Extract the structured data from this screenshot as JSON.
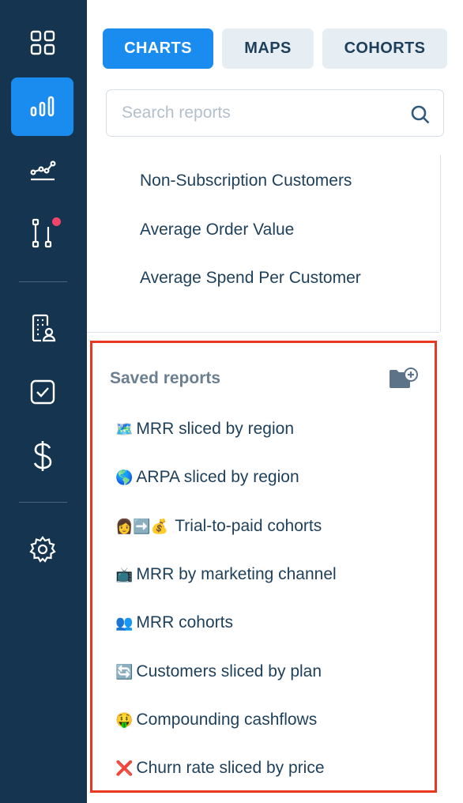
{
  "sidebar": {
    "items": [
      {
        "icon": "grid-icon"
      },
      {
        "icon": "bar-chart-icon",
        "active": true
      },
      {
        "icon": "trend-line-icon"
      },
      {
        "icon": "pipeline-icon",
        "notification": true
      },
      {
        "icon": "building-user-icon"
      },
      {
        "icon": "checkbox-icon"
      },
      {
        "icon": "dollar-icon"
      },
      {
        "icon": "gear-icon"
      }
    ]
  },
  "tabs": [
    {
      "label": "CHARTS",
      "active": true
    },
    {
      "label": "MAPS",
      "active": false
    },
    {
      "label": "COHORTS",
      "active": false
    }
  ],
  "search": {
    "placeholder": "Search reports",
    "value": ""
  },
  "reports": [
    "Non-Subscription Customers",
    "Average Order Value",
    "Average Spend Per Customer"
  ],
  "saved": {
    "title": "Saved reports",
    "new_folder_icon": "folder-plus-icon",
    "items": [
      {
        "emoji": "🗺️",
        "label": "MRR sliced by region"
      },
      {
        "emoji": "🌎",
        "label": "ARPA sliced by region"
      },
      {
        "emoji": "👩➡️💰",
        "label": "Trial-to-paid cohorts"
      },
      {
        "emoji": "📺",
        "label": "MRR by marketing channel"
      },
      {
        "emoji": "👥",
        "label": "MRR cohorts"
      },
      {
        "emoji": "🔄",
        "label": "Customers sliced by plan"
      },
      {
        "emoji": "🤑",
        "label": "Compounding cashflows"
      },
      {
        "emoji": "❌",
        "label": "Churn rate sliced by price"
      }
    ]
  },
  "colors": {
    "sidebar": "#14344f",
    "accent": "#1a8cf0",
    "highlight": "#e8381f",
    "notification": "#f0446a"
  }
}
